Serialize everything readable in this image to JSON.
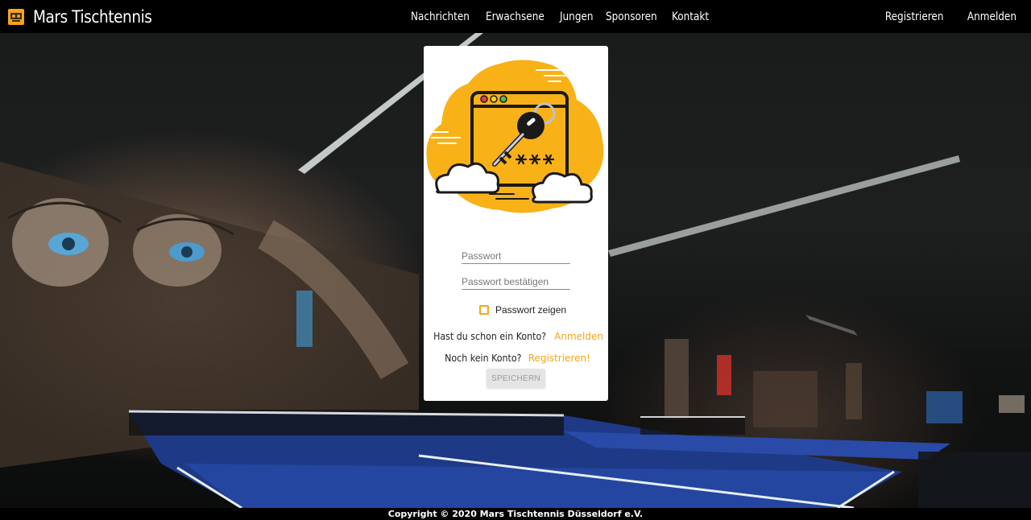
{
  "header": {
    "brand_name": "Mars Tischtennis",
    "nav": [
      {
        "label": "Nachrichten"
      },
      {
        "label": "Erwachsene"
      },
      {
        "label": "Jungen"
      },
      {
        "label": "Sponsoren"
      },
      {
        "label": "Kontakt"
      }
    ],
    "register_label": "Registrieren",
    "login_label": "Anmelden"
  },
  "form": {
    "password_placeholder": "Passwort",
    "password_confirm_placeholder": "Passwort bestätigen",
    "show_password_label": "Passwort zeigen",
    "show_password_checked": false,
    "have_account_text": "Hast du schon ein Konto?",
    "login_link": "Anmelden",
    "no_account_text": "Noch kein Konto?",
    "register_link": "Registrieren!",
    "save_label": "SPEICHERN"
  },
  "footer": {
    "copyright": "Copyright © 2020  Mars Tischtennis Düsseldorf e.V."
  },
  "colors": {
    "accent": "#f5a516",
    "nav_bg": "#000000",
    "card_bg": "#ffffff"
  },
  "icons": [
    "brand-logo-icon",
    "browser-key-illustration"
  ]
}
